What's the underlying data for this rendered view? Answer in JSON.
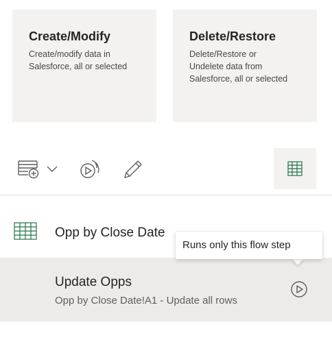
{
  "cards": [
    {
      "title": "Create/Modify",
      "description": "Create/modify data in Salesforce, all or selected"
    },
    {
      "title": "Delete/Restore",
      "description": "Delete/Restore or Undelete data from Salesforce, all or selected"
    }
  ],
  "toolbar": {
    "icons": {
      "add_step": "add-step-table-icon",
      "chevron": "chevron-down-icon",
      "run_flow": "run-flow-icon",
      "edit": "pencil-icon",
      "grid_view": "grid-view-icon"
    }
  },
  "flow": {
    "sheet_name": "Opp by Close Date",
    "sheet_icon": "table-grid-icon",
    "step": {
      "title": "Update Opps",
      "subtitle": "Opp by Close Date!A1 - Update all rows",
      "run_icon": "play-circle-icon"
    }
  },
  "tooltip": {
    "text": "Runs only this flow step"
  },
  "colors": {
    "card_bg": "#f3f2f1",
    "selected_row_bg": "#edebe9",
    "icon_gray": "#605e5c",
    "excel_green": "#217346",
    "divider": "#e1dfdd"
  }
}
